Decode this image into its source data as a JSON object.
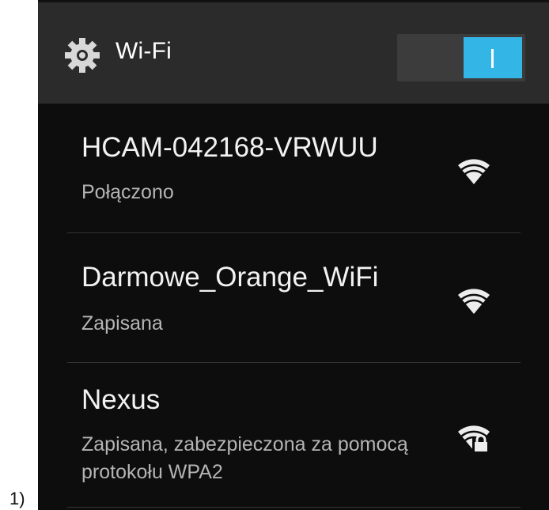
{
  "figure_label": "1)",
  "header": {
    "title": "Wi-Fi",
    "toggle_on": true,
    "accent_color": "#33b5e5",
    "icon": "gear-icon"
  },
  "networks": [
    {
      "name": "HCAM-042168-VRWUU",
      "status": "Połączono",
      "signal_icon": "wifi-signal-full-icon",
      "secured": false
    },
    {
      "name": "Darmowe_Orange_WiFi",
      "status": "Zapisana",
      "signal_icon": "wifi-signal-full-icon",
      "secured": false
    },
    {
      "name": "Nexus",
      "status": "Zapisana, zabezpieczona za pomocą protokołu WPA2",
      "signal_icon": "wifi-signal-locked-icon",
      "secured": true
    }
  ]
}
